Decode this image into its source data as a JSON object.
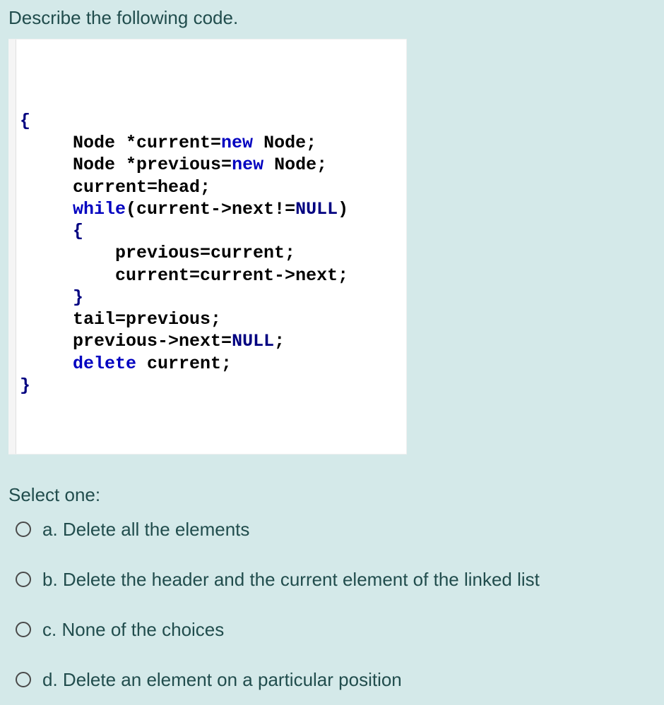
{
  "question": {
    "prompt": "Describe the following code.",
    "code_tokens": [
      {
        "t": "{",
        "c": "brace"
      },
      {
        "t": "\n",
        "c": ""
      },
      {
        "t": "     Node *current=",
        "c": ""
      },
      {
        "t": "new",
        "c": "kw"
      },
      {
        "t": " Node;",
        "c": ""
      },
      {
        "t": "\n",
        "c": ""
      },
      {
        "t": "     Node *previous=",
        "c": ""
      },
      {
        "t": "new",
        "c": "kw"
      },
      {
        "t": " Node;",
        "c": ""
      },
      {
        "t": "\n",
        "c": ""
      },
      {
        "t": "     current=head;",
        "c": ""
      },
      {
        "t": "\n",
        "c": ""
      },
      {
        "t": "     ",
        "c": ""
      },
      {
        "t": "while",
        "c": "kw"
      },
      {
        "t": "(current->next!=",
        "c": ""
      },
      {
        "t": "NULL",
        "c": "null"
      },
      {
        "t": ")",
        "c": ""
      },
      {
        "t": "\n",
        "c": ""
      },
      {
        "t": "     ",
        "c": ""
      },
      {
        "t": "{",
        "c": "brace"
      },
      {
        "t": "\n",
        "c": ""
      },
      {
        "t": "         previous=current;",
        "c": ""
      },
      {
        "t": "\n",
        "c": ""
      },
      {
        "t": "         current=current->next;",
        "c": ""
      },
      {
        "t": "\n",
        "c": ""
      },
      {
        "t": "     ",
        "c": ""
      },
      {
        "t": "}",
        "c": "brace"
      },
      {
        "t": "\n",
        "c": ""
      },
      {
        "t": "     tail=previous;",
        "c": ""
      },
      {
        "t": "\n",
        "c": ""
      },
      {
        "t": "     previous->next=",
        "c": ""
      },
      {
        "t": "NULL",
        "c": "null"
      },
      {
        "t": ";",
        "c": ""
      },
      {
        "t": "\n",
        "c": ""
      },
      {
        "t": "     ",
        "c": ""
      },
      {
        "t": "delete",
        "c": "kw"
      },
      {
        "t": " current;",
        "c": ""
      },
      {
        "t": "\n",
        "c": ""
      },
      {
        "t": "}",
        "c": "brace"
      }
    ],
    "select_label": "Select one:",
    "options": [
      {
        "letter": "a.",
        "text": "Delete all the elements"
      },
      {
        "letter": "b.",
        "text": "Delete the header and the current element of the linked list"
      },
      {
        "letter": "c.",
        "text": "None of the choices"
      },
      {
        "letter": "d.",
        "text": "Delete an element on a particular position"
      }
    ]
  }
}
